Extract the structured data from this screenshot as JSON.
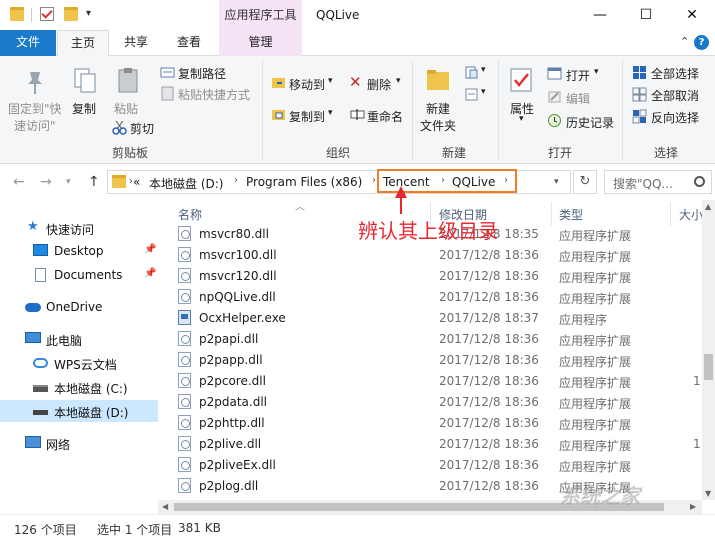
{
  "titlebar": {
    "context_tab_title": "应用程序工具",
    "window_title": "QQLive",
    "minimize": "—",
    "maximize": "☐",
    "close": "✕"
  },
  "tabs": {
    "file": "文件",
    "home": "主页",
    "share": "共享",
    "view": "查看",
    "manage": "管理"
  },
  "ribbon": {
    "clipboard": {
      "pin": "固定到\"快",
      "pin2": "速访问\"",
      "copy": "复制",
      "paste": "粘贴",
      "copy_path": "复制路径",
      "paste_shortcut": "粘贴快捷方式",
      "cut": "剪切",
      "label": "剪贴板"
    },
    "organize": {
      "move_to": "移动到",
      "copy_to": "复制到",
      "delete": "删除",
      "rename": "重命名",
      "label": "组织"
    },
    "new": {
      "new_folder": "新建",
      "new_folder2": "文件夹",
      "label": "新建"
    },
    "open": {
      "properties": "属性",
      "open": "打开",
      "edit": "编辑",
      "history": "历史记录",
      "label": "打开"
    },
    "select": {
      "select_all": "全部选择",
      "select_none": "全部取消",
      "invert": "反向选择",
      "label": "选择"
    }
  },
  "address": {
    "overflow": "«",
    "crumbs": [
      "本地磁盘 (D:)",
      "Program Files (x86)",
      "Tencent",
      "QQLive"
    ],
    "search_placeholder": "搜索\"QQ..."
  },
  "navpane": {
    "items": [
      {
        "label": "快速访问"
      },
      {
        "label": "Desktop"
      },
      {
        "label": "Documents"
      },
      {
        "label": "OneDrive"
      },
      {
        "label": "此电脑"
      },
      {
        "label": "WPS云文档"
      },
      {
        "label": "本地磁盘 (C:)"
      },
      {
        "label": "本地磁盘 (D:)"
      },
      {
        "label": "网络"
      }
    ]
  },
  "columns": {
    "name": "名称",
    "date": "修改日期",
    "type": "类型",
    "size": "大小"
  },
  "files": [
    {
      "name": "msvcr80.dll",
      "date": "2017/12/8 18:35",
      "type": "应用程序扩展",
      "size": ""
    },
    {
      "name": "msvcr100.dll",
      "date": "2017/12/8 18:36",
      "type": "应用程序扩展",
      "size": ""
    },
    {
      "name": "msvcr120.dll",
      "date": "2017/12/8 18:36",
      "type": "应用程序扩展",
      "size": ""
    },
    {
      "name": "npQQLive.dll",
      "date": "2017/12/8 18:36",
      "type": "应用程序扩展",
      "size": ""
    },
    {
      "name": "OcxHelper.exe",
      "date": "2017/12/8 18:37",
      "type": "应用程序",
      "size": ""
    },
    {
      "name": "p2papi.dll",
      "date": "2017/12/8 18:36",
      "type": "应用程序扩展",
      "size": ""
    },
    {
      "name": "p2papp.dll",
      "date": "2017/12/8 18:36",
      "type": "应用程序扩展",
      "size": ""
    },
    {
      "name": "p2pcore.dll",
      "date": "2017/12/8 18:36",
      "type": "应用程序扩展",
      "size": "1"
    },
    {
      "name": "p2pdata.dll",
      "date": "2017/12/8 18:36",
      "type": "应用程序扩展",
      "size": ""
    },
    {
      "name": "p2phttp.dll",
      "date": "2017/12/8 18:36",
      "type": "应用程序扩展",
      "size": ""
    },
    {
      "name": "p2plive.dll",
      "date": "2017/12/8 18:36",
      "type": "应用程序扩展",
      "size": "1"
    },
    {
      "name": "p2pliveEx.dll",
      "date": "2017/12/8 18:36",
      "type": "应用程序扩展",
      "size": ""
    },
    {
      "name": "p2plog.dll",
      "date": "2017/12/8 18:36",
      "type": "应用程序扩展",
      "size": ""
    }
  ],
  "status": {
    "count": "126 个项目",
    "selected": "选中 1 个项目",
    "size": "381 KB"
  },
  "annotation": "辨认其上级目录",
  "watermark": "系统之家"
}
